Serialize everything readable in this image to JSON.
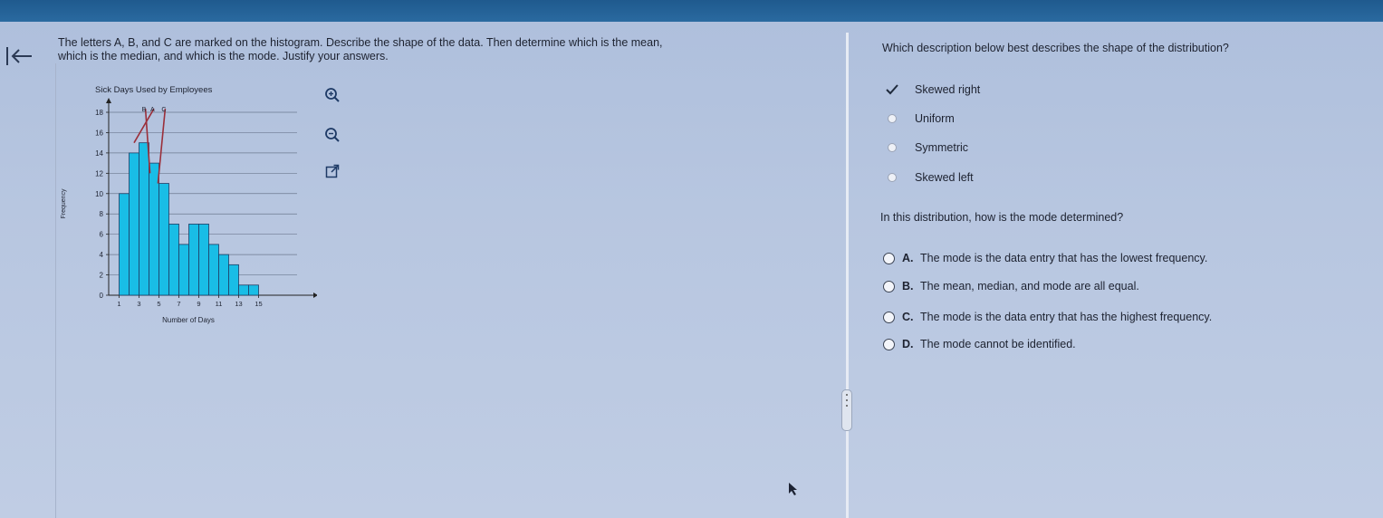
{
  "problem": {
    "line1": "The letters A, B, and C are marked on the histogram. Describe the shape of the data. Then determine which is the mean,",
    "line2": "which is the median, and which is the mode. Justify your answers."
  },
  "icons": {
    "back": "back-arrow-icon",
    "zoom_in": "zoom-in-icon",
    "zoom_out": "zoom-out-icon",
    "popout": "popout-icon"
  },
  "colors": {
    "bar": "#19bde6",
    "bar_edge": "#1f3d66",
    "marker_line": "#9b2f3a",
    "header": "#1f5a8e"
  },
  "chart_data": {
    "type": "bar",
    "title": "Sick Days Used by Employees",
    "xlabel": "Number of Days",
    "ylabel": "Frequency",
    "x_tick_labels": [
      "1",
      "3",
      "5",
      "7",
      "9",
      "11",
      "13",
      "15"
    ],
    "y_tick_labels": [
      "0",
      "2",
      "4",
      "6",
      "8",
      "10",
      "12",
      "14",
      "16",
      "18"
    ],
    "ylim": [
      0,
      18
    ],
    "grid": "horizontal",
    "bins": [
      1,
      2,
      3,
      4,
      5,
      6,
      7,
      8,
      9,
      10,
      11,
      12,
      13,
      14
    ],
    "values": [
      10,
      14,
      15,
      13,
      11,
      7,
      5,
      7,
      7,
      5,
      4,
      3,
      1,
      1
    ],
    "markers": [
      {
        "label": "A",
        "at": 2.5
      },
      {
        "label": "B",
        "at": 4.1
      },
      {
        "label": "C",
        "at": 4.9
      }
    ]
  },
  "shape_question": {
    "prompt": "Which description below best describes the shape of the distribution?",
    "options": [
      {
        "label": "Skewed right",
        "selected": true
      },
      {
        "label": "Uniform",
        "selected": false
      },
      {
        "label": "Symmetric",
        "selected": false
      },
      {
        "label": "Skewed left",
        "selected": false
      }
    ]
  },
  "mode_question": {
    "prompt": "In this distribution, how is the mode determined?",
    "options": [
      {
        "letter": "A.",
        "text": "The mode is the data entry that has the lowest frequency."
      },
      {
        "letter": "B.",
        "text": "The mean, median, and mode are all equal."
      },
      {
        "letter": "C.",
        "text": "The mode is the data entry that has the highest frequency."
      },
      {
        "letter": "D.",
        "text": "The mode cannot be identified."
      }
    ]
  }
}
